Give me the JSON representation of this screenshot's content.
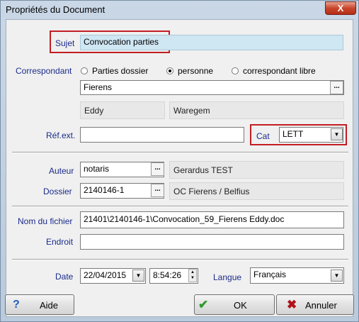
{
  "window": {
    "title": "Propriétés du Document",
    "close_label": "X"
  },
  "sujet": {
    "label": "Sujet",
    "value": "Convocation parties"
  },
  "correspondant": {
    "label": "Correspondant",
    "options": [
      "Parties dossier",
      "personne",
      "correspondant libre"
    ],
    "selected": "personne",
    "name": "Fierens",
    "firstname": "Eddy",
    "city": "Waregem"
  },
  "refext": {
    "label": "Réf.ext.",
    "value": ""
  },
  "cat": {
    "label": "Cat",
    "value": "LETT"
  },
  "auteur": {
    "label": "Auteur",
    "value": "notaris",
    "name": "Gerardus TEST"
  },
  "dossier": {
    "label": "Dossier",
    "value": "2140146-1",
    "description": "OC  Fierens / Belfius"
  },
  "fichier": {
    "label": "Nom du fichier",
    "value": "21401\\2140146-1\\Convocation_59_Fierens Eddy.doc"
  },
  "endroit": {
    "label": "Endroit",
    "value": ""
  },
  "date": {
    "label": "Date",
    "value": "22/04/2015",
    "time": "8:54:26"
  },
  "langue": {
    "label": "Langue",
    "value": "Français"
  },
  "buttons": {
    "help": "Aide",
    "ok": "OK",
    "cancel": "Annuler"
  },
  "icons": {
    "ellipsis": "...",
    "dropdown": "▼",
    "help": "?",
    "ok": "✔",
    "cancel": "✖"
  },
  "colors": {
    "label_blue": "#1a2b8a",
    "highlight_red": "#c21e24",
    "sujet_bg": "#cfe6f3"
  }
}
